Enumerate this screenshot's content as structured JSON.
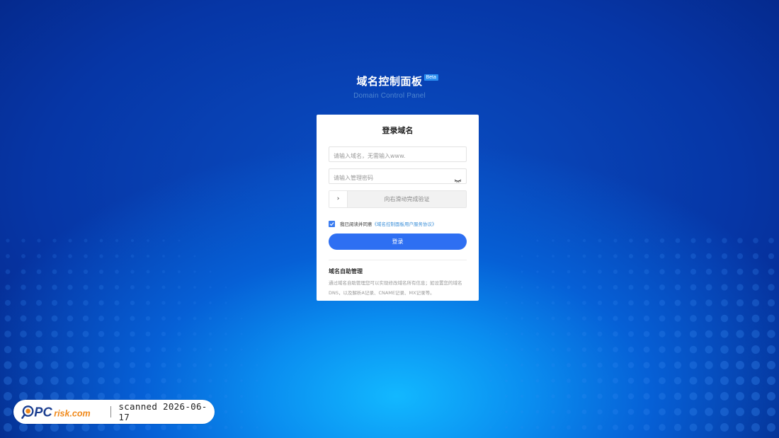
{
  "header": {
    "title": "域名控制面板",
    "badge": "Beta",
    "subtitle": "Domain Control Panel"
  },
  "login_card": {
    "title": "登录域名",
    "domain_input": {
      "placeholder": "请输入域名，无需输入www.",
      "value": ""
    },
    "password_input": {
      "placeholder": "请输入管理密码",
      "value": ""
    },
    "slider": {
      "handle_glyph": "›",
      "text": "向右滑动完成验证"
    },
    "agreement": {
      "checked": true,
      "text": "我已阅读并同意",
      "link": "《域名控制面板用户服务协议》"
    },
    "login_button": "登录",
    "info": {
      "title": "域名自助管理",
      "text": "通过域名自助管理您可以实现修改域名所有信息；如设置您的域名DNS，以及解析A记录、CNAME记录、MX记录等。"
    }
  },
  "watermark": {
    "logo_text_pc": "PC",
    "logo_text_risk": "risk.com",
    "scan_text": "scanned 2026-06-17"
  },
  "colors": {
    "background_dark": "#042a8c",
    "background_glow": "#12b8ff",
    "primary_button": "#2e6ff2",
    "link": "#3b8fd8",
    "badge": "#2b8ff2",
    "watermark_orange": "#f08a1c",
    "watermark_blue": "#1a3d8f"
  },
  "icons": {
    "password_toggle": "eye-closed-icon",
    "slider_handle": "chevron-right-icon",
    "checkbox": "checkmark-icon"
  }
}
